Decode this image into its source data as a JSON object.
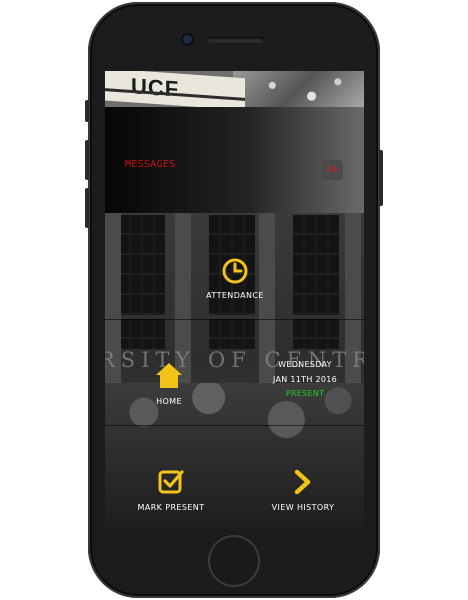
{
  "banner": {
    "logo_text": "UCF"
  },
  "messages": {
    "label": "MESSAGES",
    "count": "14"
  },
  "building": {
    "sign_text": "RSITY OF CENTRAL"
  },
  "tiles": {
    "attendance": {
      "label": "ATTENDANCE",
      "icon": "clock-icon"
    },
    "home": {
      "label": "HOME",
      "icon": "house-icon"
    },
    "mark_present": {
      "label": "MARK PRESENT",
      "icon": "checkbox-icon"
    },
    "view_history": {
      "label": "VIEW HISTORY",
      "icon": "chevron-right-icon"
    }
  },
  "date_panel": {
    "weekday": "WEDNESDAY",
    "date": "JAN 11TH 2016",
    "status": "PRESENT"
  },
  "colors": {
    "accent_yellow": "#f2c41a",
    "message_red": "#cc1111",
    "status_green": "#22cc22"
  }
}
